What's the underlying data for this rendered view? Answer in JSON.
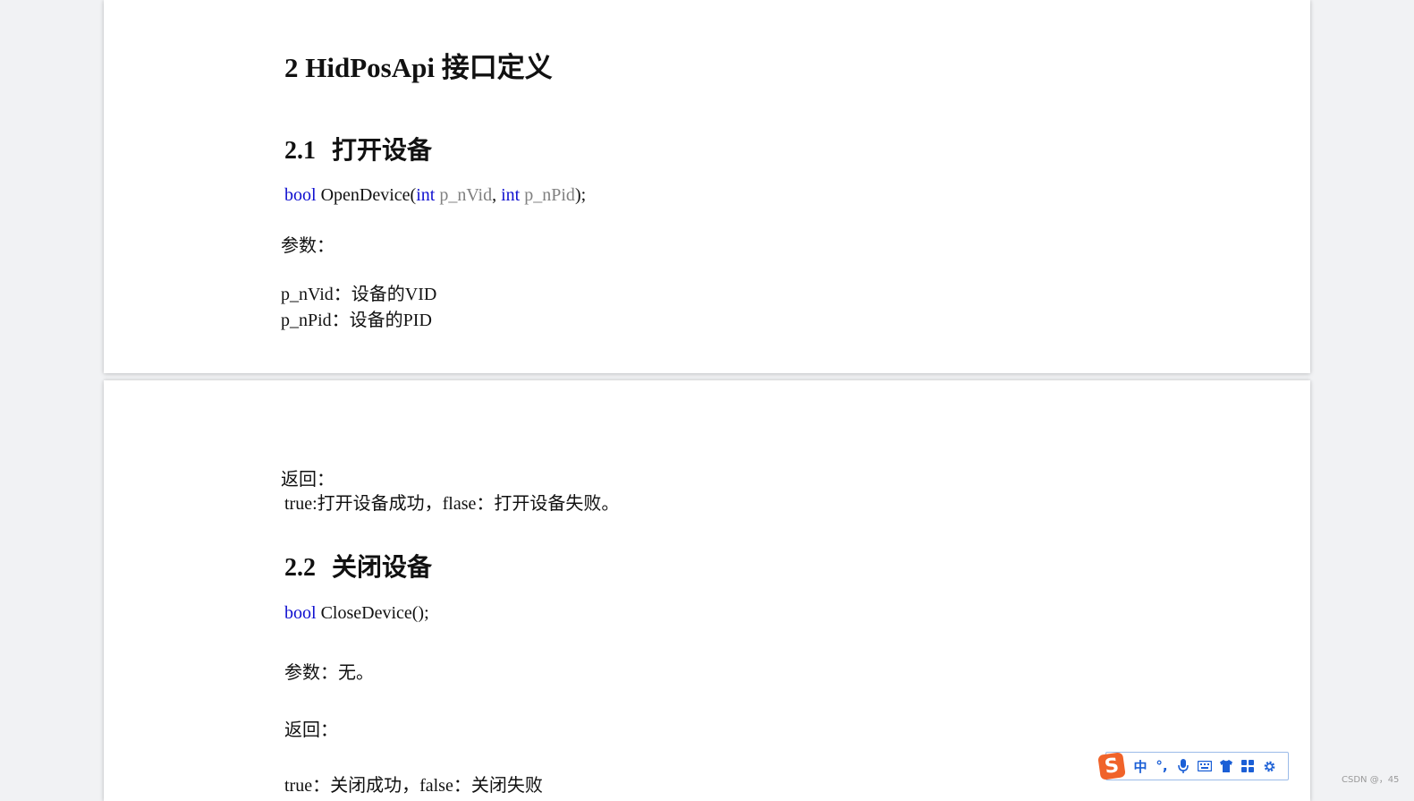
{
  "page1": {
    "heading": "2 HidPosApi 接口定义",
    "section_num": "2.1",
    "section_title": "打开设备",
    "sig": {
      "ret_type": "bool",
      "name": "OpenDevice(",
      "type1": "int",
      "param1": "p_nVid",
      "sep": ",",
      "type2": "int",
      "param2": "p_nPid",
      "close": ");"
    },
    "params_label": "参数：",
    "param_line1": "p_nVid：设备的VID",
    "param_line2": "p_nPid：设备的PID"
  },
  "page2": {
    "return_label": "返回：",
    "return_text": "true:打开设备成功，flase：打开设备失败。",
    "section_num": "2.2",
    "section_title": "关闭设备",
    "sig": {
      "ret_type": "bool",
      "name": "CloseDevice();"
    },
    "params_line": "参数：无。",
    "return_label2": "返回：",
    "return_text2": "true：关闭成功，false：关闭失败"
  },
  "ime_toolbar": {
    "logo": "S",
    "mode": "中",
    "punct": "°,",
    "icons": [
      "mic-icon",
      "keyboard-icon",
      "skin-shirt-icon",
      "toolbox-grid-icon",
      "settings-gear-icon"
    ],
    "accent": "#1b5fd6",
    "logo_color": "#f0632a"
  },
  "watermark": "CSDN @，45"
}
